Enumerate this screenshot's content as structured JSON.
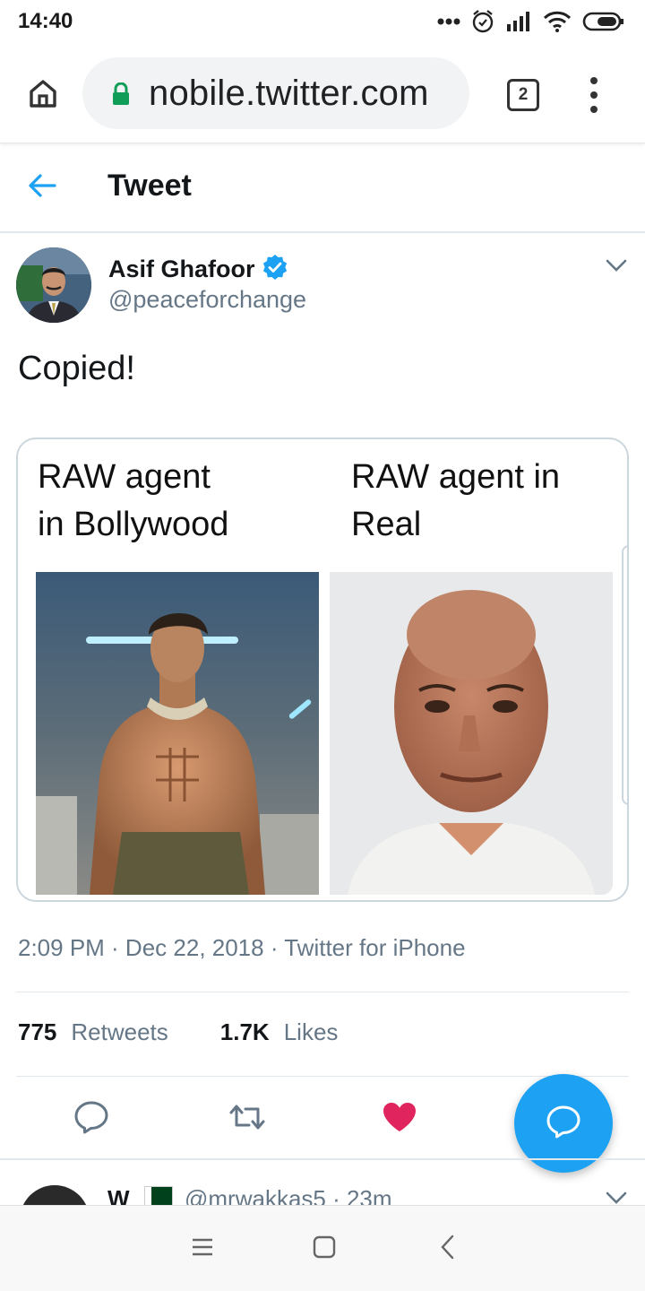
{
  "status_bar": {
    "time": "14:40",
    "icons": [
      "more-dots-icon",
      "alarm-icon",
      "signal-icon",
      "wifi-icon",
      "battery-icon"
    ]
  },
  "browser": {
    "url": "nobile.twitter.com",
    "tab_count": "2",
    "icons": [
      "home-icon",
      "lock-icon",
      "tabs-icon",
      "overflow-menu-icon"
    ],
    "lock_color": "#0f9d58"
  },
  "page_header": {
    "title": "Tweet",
    "back_icon": "back-arrow-icon"
  },
  "tweet": {
    "author_name": "Asif Ghafoor",
    "verified": true,
    "author_handle": "@peaceforchange",
    "text": "Copied!",
    "media": {
      "left_caption": "RAW agent\nin Bollywood",
      "right_caption": "RAW agent in\nReal"
    },
    "meta": "2:09 PM · Dec 22, 2018 · Twitter for iPhone",
    "retweet_count": "775",
    "retweet_label": "Retweets",
    "like_count": "1.7K",
    "like_label": "Likes",
    "liked": true,
    "actions": [
      "reply-icon",
      "retweet-icon",
      "like-icon"
    ]
  },
  "next_reply": {
    "name": "W",
    "handle": "@mrwakkas5 · 23m"
  },
  "colors": {
    "accent": "#1da1f2",
    "like": "#e0245e",
    "muted_text": "#657786",
    "border": "#e1e8ed"
  }
}
